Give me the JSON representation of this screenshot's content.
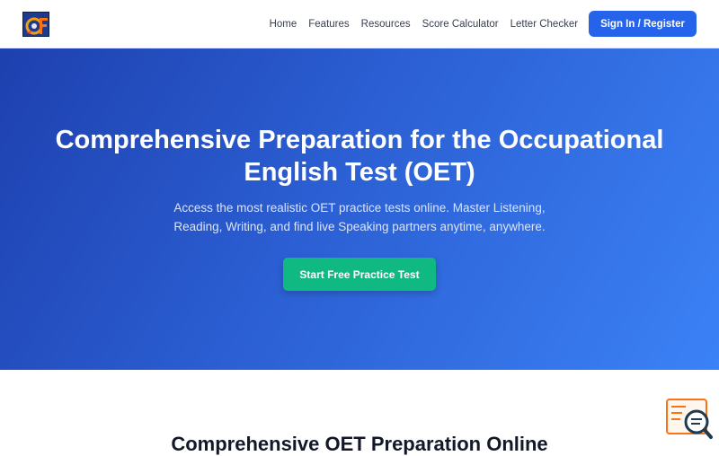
{
  "nav": {
    "logo_icon": "oet-logo-icon",
    "links": [
      "Home",
      "Features",
      "Resources",
      "Score Calculator",
      "Letter Checker"
    ],
    "signin_label": "Sign In / Register"
  },
  "hero": {
    "title": "Comprehensive Preparation for the Occupational English Test (OET)",
    "subtitle": "Access the most realistic OET practice tests online. Master Listening, Reading, Writing, and find live Speaking partners anytime, anywhere.",
    "cta_label": "Start Free Practice Test"
  },
  "section": {
    "heading": "Comprehensive OET Preparation Online"
  },
  "widget": {
    "icon": "search-document-icon"
  },
  "colors": {
    "primary": "#2563eb",
    "cta": "#10b981",
    "hero_start": "#1e40af",
    "hero_end": "#3b82f6",
    "widget_accent": "#f97316",
    "widget_dark": "#1f3b4d"
  }
}
